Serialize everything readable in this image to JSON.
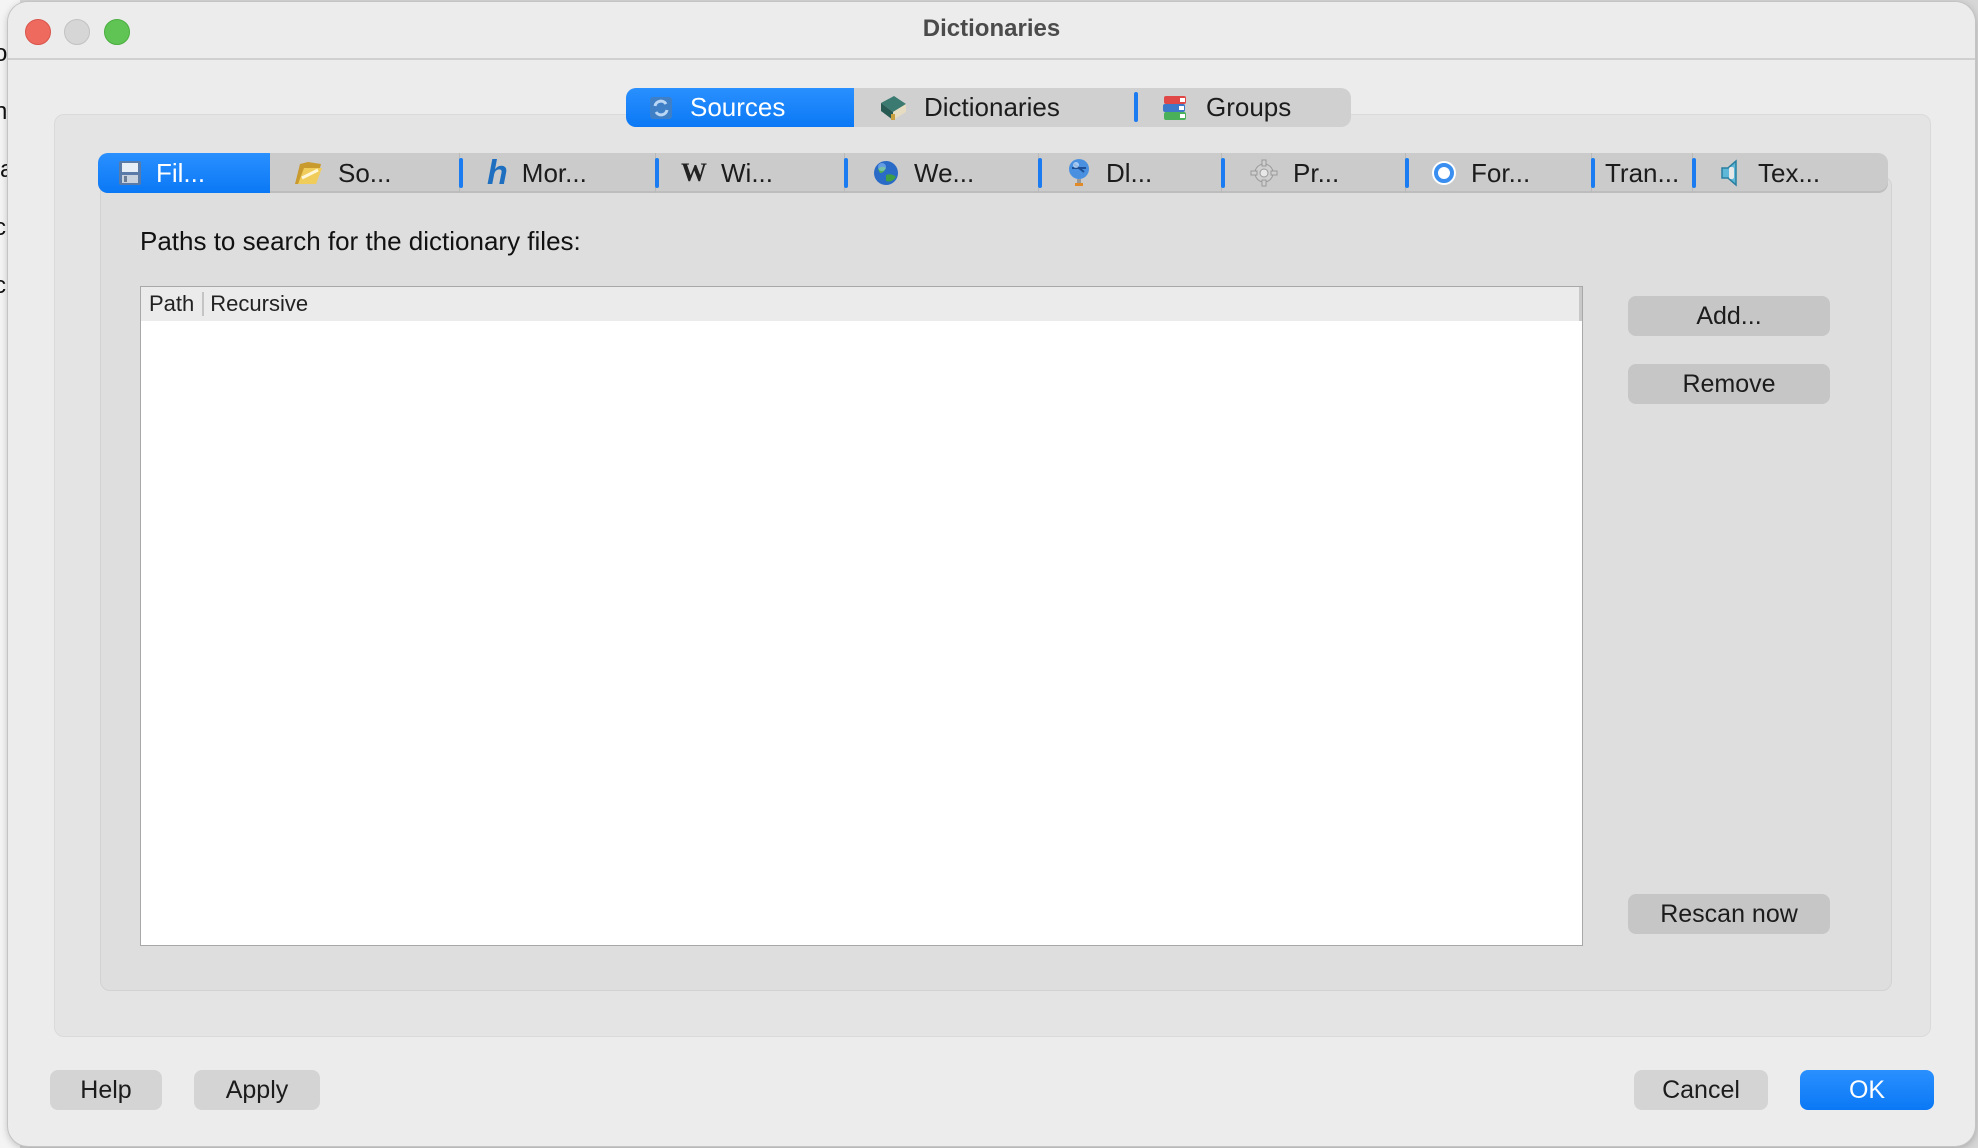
{
  "background_window": {
    "fragments": [
      "ou",
      "ne",
      "a",
      "c",
      "c"
    ]
  },
  "window": {
    "title": "Dictionaries",
    "controls": [
      "close",
      "minimize",
      "maximize"
    ]
  },
  "outer_tabs": [
    {
      "label": "Sources",
      "icon": "refresh-icon",
      "active": true
    },
    {
      "label": "Dictionaries",
      "icon": "book-icon",
      "active": false
    },
    {
      "label": "Groups",
      "icon": "books-stack-icon",
      "active": false
    }
  ],
  "inner_tabs": [
    {
      "label": "Fil...",
      "icon": "floppy-icon",
      "active": true
    },
    {
      "label": "So...",
      "icon": "folder-icon",
      "active": false
    },
    {
      "label": "Mor...",
      "icon": "hunspell-h-icon",
      "active": false
    },
    {
      "label": "Wi...",
      "icon": "wikipedia-icon",
      "active": false
    },
    {
      "label": "We...",
      "icon": "globe-icon",
      "active": false
    },
    {
      "label": "Dl...",
      "icon": "network-globe-icon",
      "active": false
    },
    {
      "label": "Pr...",
      "icon": "gear-icon",
      "active": false
    },
    {
      "label": "For...",
      "icon": "forvo-icon",
      "active": false
    },
    {
      "label": "Tran...",
      "icon": "",
      "active": false
    },
    {
      "label": "Tex...",
      "icon": "speaker-icon",
      "active": false
    }
  ],
  "files_panel": {
    "label": "Paths to search for the dictionary files:",
    "table": {
      "columns": [
        "Path",
        "Recursive"
      ],
      "rows": []
    },
    "buttons": {
      "add": "Add...",
      "remove": "Remove",
      "rescan": "Rescan now"
    }
  },
  "footer": {
    "help": "Help",
    "apply": "Apply",
    "cancel": "Cancel",
    "ok": "OK"
  },
  "colors": {
    "accent": "#0a7af5",
    "tab_separator": "#1a7cf0"
  }
}
